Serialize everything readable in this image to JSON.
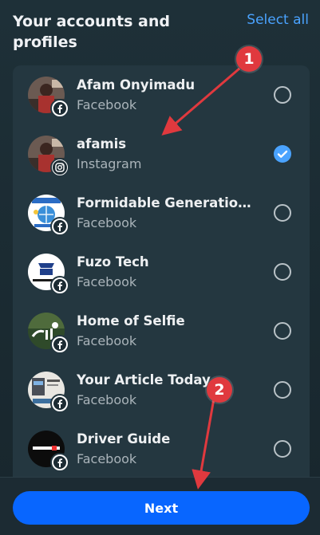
{
  "header": {
    "title": "Your accounts and profiles",
    "select_all": "Select all"
  },
  "accounts": [
    {
      "name": "Afam Onyimadu",
      "platform": "Facebook",
      "badge_icon": "facebook-icon",
      "selected": false
    },
    {
      "name": "afamis",
      "platform": "Instagram",
      "badge_icon": "instagram-icon",
      "selected": true
    },
    {
      "name": "Formidable Generation'...",
      "platform": "Facebook",
      "badge_icon": "facebook-icon",
      "selected": false
    },
    {
      "name": "Fuzo Tech",
      "platform": "Facebook",
      "badge_icon": "facebook-icon",
      "selected": false
    },
    {
      "name": "Home of Selfie",
      "platform": "Facebook",
      "badge_icon": "facebook-icon",
      "selected": false
    },
    {
      "name": "Your Article Today",
      "platform": "Facebook",
      "badge_icon": "facebook-icon",
      "selected": false
    },
    {
      "name": "Driver Guide",
      "platform": "Facebook",
      "badge_icon": "facebook-icon",
      "selected": false
    }
  ],
  "footer": {
    "next_label": "Next"
  },
  "annotations": [
    {
      "label": "1"
    },
    {
      "label": "2"
    }
  ],
  "colors": {
    "accent": "#0866ff",
    "link": "#4aa3ff",
    "marker": "#e0393e",
    "background": "#1c2b33"
  }
}
